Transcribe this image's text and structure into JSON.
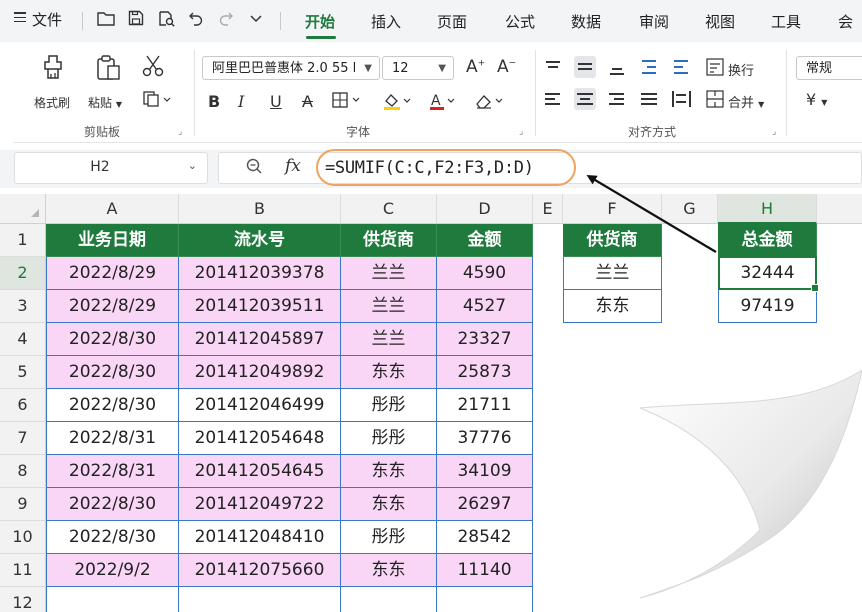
{
  "menubar": {
    "file_label": "文件",
    "tabs": [
      "开始",
      "插入",
      "页面",
      "公式",
      "数据",
      "审阅",
      "视图",
      "工具",
      "会"
    ],
    "active_tab": "开始"
  },
  "ribbon": {
    "clipboard": {
      "format_painter": "格式刷",
      "paste": "粘贴",
      "group_title": "剪贴板"
    },
    "font": {
      "font_name": "阿里巴巴普惠体 2.0 55 l",
      "font_size": "12",
      "group_title": "字体"
    },
    "align": {
      "wrap_text": "换行",
      "merge": "合并",
      "group_title": "对齐方式"
    },
    "number": {
      "format": "常规",
      "currency_symbol": "¥"
    }
  },
  "formula_bar": {
    "name_box": "H2",
    "fx": "fx",
    "formula": "=SUMIF(C:C,F2:F3,D:D)"
  },
  "sheet": {
    "columns": [
      "A",
      "B",
      "C",
      "D",
      "E",
      "F",
      "G",
      "H"
    ],
    "selected_column": "H",
    "row_numbers": [
      "1",
      "2",
      "3",
      "4",
      "5",
      "6",
      "7",
      "8",
      "9",
      "10",
      "11",
      "12"
    ],
    "selected_row": "2",
    "table_headers": [
      "业务日期",
      "流水号",
      "供货商",
      "金额"
    ],
    "rows": [
      [
        "2022/8/29",
        "201412039378",
        "兰兰",
        "4590"
      ],
      [
        "2022/8/29",
        "201412039511",
        "兰兰",
        "4527"
      ],
      [
        "2022/8/30",
        "201412045897",
        "兰兰",
        "23327"
      ],
      [
        "2022/8/30",
        "201412049892",
        "东东",
        "25873"
      ],
      [
        "2022/8/30",
        "201412046499",
        "彤彤",
        "21711"
      ],
      [
        "2022/8/31",
        "201412054648",
        "彤彤",
        "37776"
      ],
      [
        "2022/8/31",
        "201412054645",
        "东东",
        "34109"
      ],
      [
        "2022/8/30",
        "201412049722",
        "东东",
        "26297"
      ],
      [
        "2022/8/30",
        "201412048410",
        "彤彤",
        "28542"
      ],
      [
        "2022/9/2",
        "201412075660",
        "东东",
        "11140"
      ]
    ],
    "summary": {
      "supplier_header": "供货商",
      "total_header": "总金额",
      "suppliers": [
        "兰兰",
        "东东"
      ],
      "totals": [
        "32444",
        "97419"
      ]
    }
  },
  "colors": {
    "accent_green": "#1f7a3e",
    "row_pink": "#f9d6f6",
    "highlight_orange": "#f0a35e",
    "table_border_blue": "#3b78c4"
  }
}
